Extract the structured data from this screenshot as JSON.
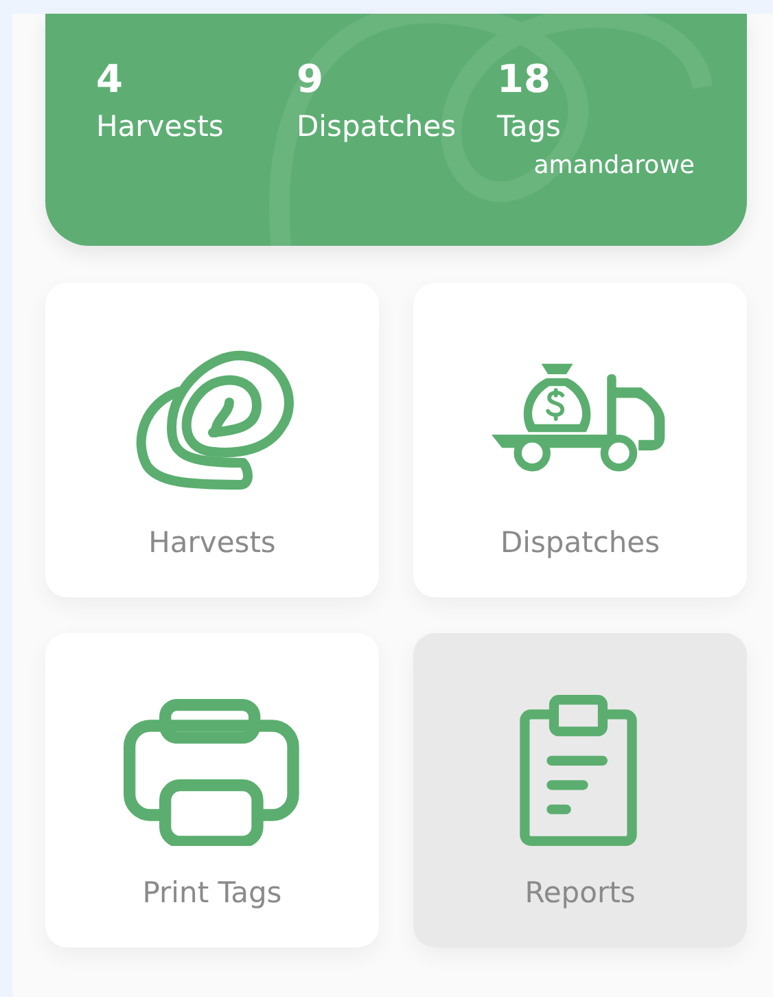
{
  "summary": {
    "stats": [
      {
        "value": "4",
        "label": "Harvests"
      },
      {
        "value": "9",
        "label": "Dispatches"
      },
      {
        "value": "18",
        "label": "Tags"
      }
    ],
    "user": "amandarowe"
  },
  "tiles": [
    {
      "label": "Harvests",
      "selected": false
    },
    {
      "label": "Dispatches",
      "selected": false
    },
    {
      "label": "Print Tags",
      "selected": false
    },
    {
      "label": "Reports",
      "selected": true
    }
  ]
}
